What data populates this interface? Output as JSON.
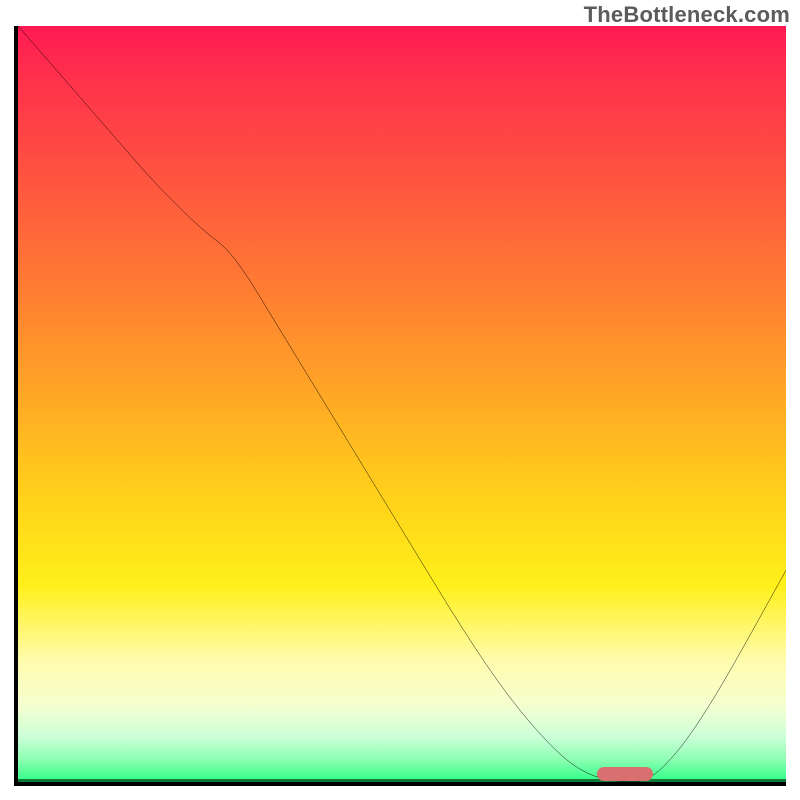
{
  "watermark": "TheBottleneck.com",
  "chart_data": {
    "type": "line",
    "title": "",
    "xlabel": "",
    "ylabel": "",
    "xlim": [
      0,
      100
    ],
    "ylim": [
      0,
      100
    ],
    "grid": false,
    "legend": false,
    "background": {
      "type": "vertical-gradient",
      "stops": [
        {
          "pos": 0,
          "color": "#ff1a52"
        },
        {
          "pos": 20,
          "color": "#ff5440"
        },
        {
          "pos": 48,
          "color": "#ffa526"
        },
        {
          "pos": 74,
          "color": "#fff01a"
        },
        {
          "pos": 90,
          "color": "#f4ffd0"
        },
        {
          "pos": 100,
          "color": "#2dff86"
        }
      ]
    },
    "series": [
      {
        "name": "bottleneck-curve",
        "color": "#000000",
        "x": [
          0,
          6,
          12,
          18,
          24,
          28,
          34,
          40,
          46,
          52,
          58,
          64,
          70,
          74,
          78,
          82,
          86,
          90,
          94,
          100
        ],
        "y": [
          100,
          93,
          86,
          79,
          73,
          70,
          60,
          50,
          40,
          30,
          20,
          11,
          4,
          1,
          0,
          0,
          4,
          10,
          17,
          28
        ]
      }
    ],
    "marker": {
      "name": "optimal-range",
      "x": 79,
      "y": 1,
      "color": "#d9706f",
      "shape": "pill"
    }
  }
}
